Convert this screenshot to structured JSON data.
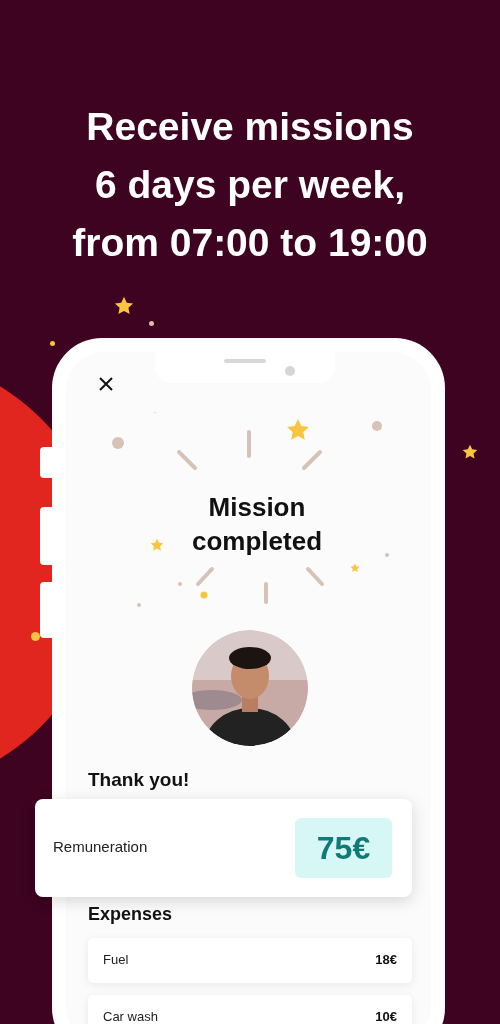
{
  "headline": [
    "Receive missions",
    "6 days per week,",
    "from 07:00 to 19:00"
  ],
  "title_lines": [
    "Mission",
    "completed"
  ],
  "thank_you": "Thank you!",
  "remuneration": {
    "label": "Remuneration",
    "amount": "75€"
  },
  "expenses": {
    "title": "Expenses",
    "items": [
      {
        "label": "Fuel",
        "amount": "18€"
      },
      {
        "label": "Car wash",
        "amount": "10€"
      }
    ]
  }
}
